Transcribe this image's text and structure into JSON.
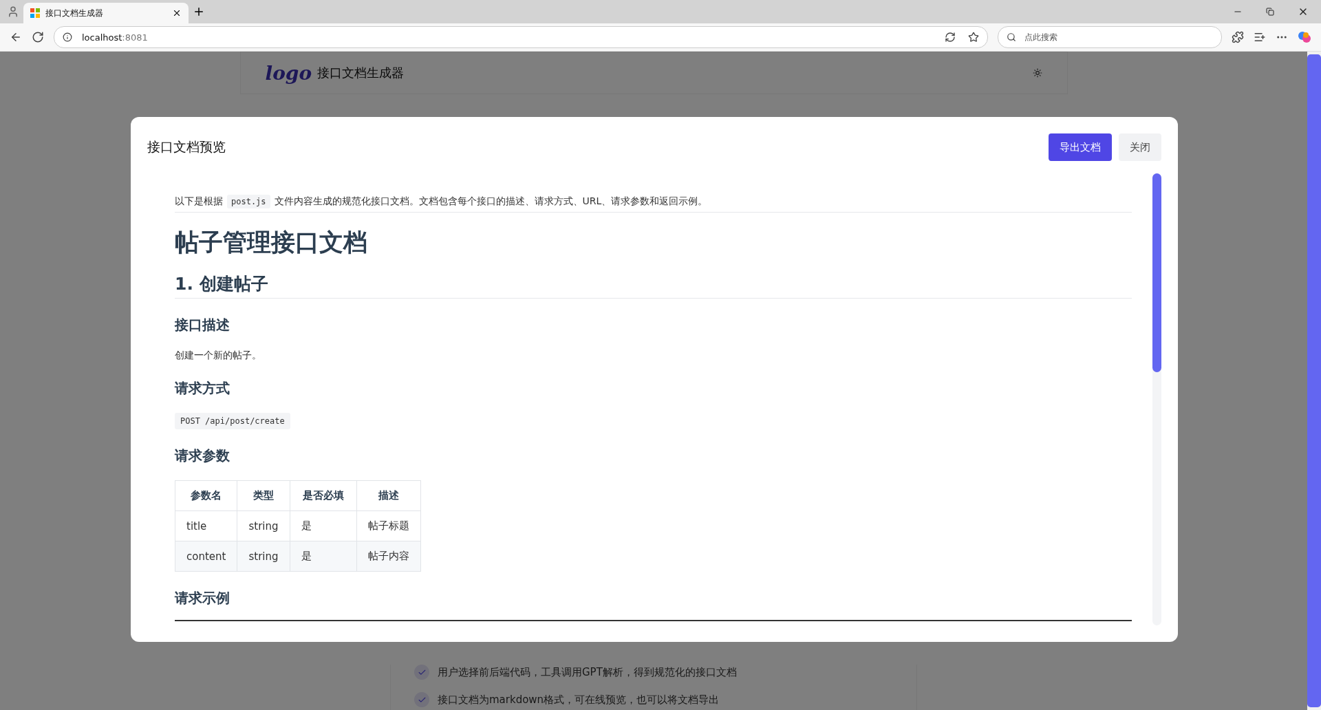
{
  "browser": {
    "tab_title": "接口文档生成器",
    "url_host": "localhost",
    "url_port": ":8081",
    "search_placeholder": "点此搜索"
  },
  "app_header": {
    "logo": "logo",
    "title": "接口文档生成器"
  },
  "background_features": [
    {
      "text": "用户选择前后端代码，工具调用GPT解析，得到规范化的接口文档"
    },
    {
      "text": "接口文档为markdown格式，可在线预览，也可以将文档导出"
    }
  ],
  "modal": {
    "title": "接口文档预览",
    "buttons": [
      {
        "label": "导出文档",
        "kind": "primary"
      },
      {
        "label": "关闭",
        "kind": "secondary"
      }
    ],
    "document": [
      {
        "kind": "intro",
        "before": "以下是根据",
        "code": "post.js",
        "after": "文件内容生成的规范化接口文档。文档包含每个接口的描述、请求方式、URL、请求参数和返回示例。"
      },
      {
        "kind": "h1",
        "text": "帖子管理接口文档"
      },
      {
        "kind": "h2",
        "text": "1. 创建帖子"
      },
      {
        "kind": "h3",
        "text": "接口描述"
      },
      {
        "kind": "p",
        "text": "创建一个新的帖子。"
      },
      {
        "kind": "h3",
        "text": "请求方式"
      },
      {
        "kind": "code",
        "text": "POST /api/post/create"
      },
      {
        "kind": "h3",
        "text": "请求参数"
      },
      {
        "kind": "table",
        "columns": [
          "参数名",
          "类型",
          "是否必填",
          "描述"
        ],
        "rows": [
          [
            "title",
            "string",
            "是",
            "帖子标题"
          ],
          [
            "content",
            "string",
            "是",
            "帖子内容"
          ]
        ]
      },
      {
        "kind": "h3",
        "text": "请求示例"
      },
      {
        "kind": "rule"
      }
    ]
  }
}
